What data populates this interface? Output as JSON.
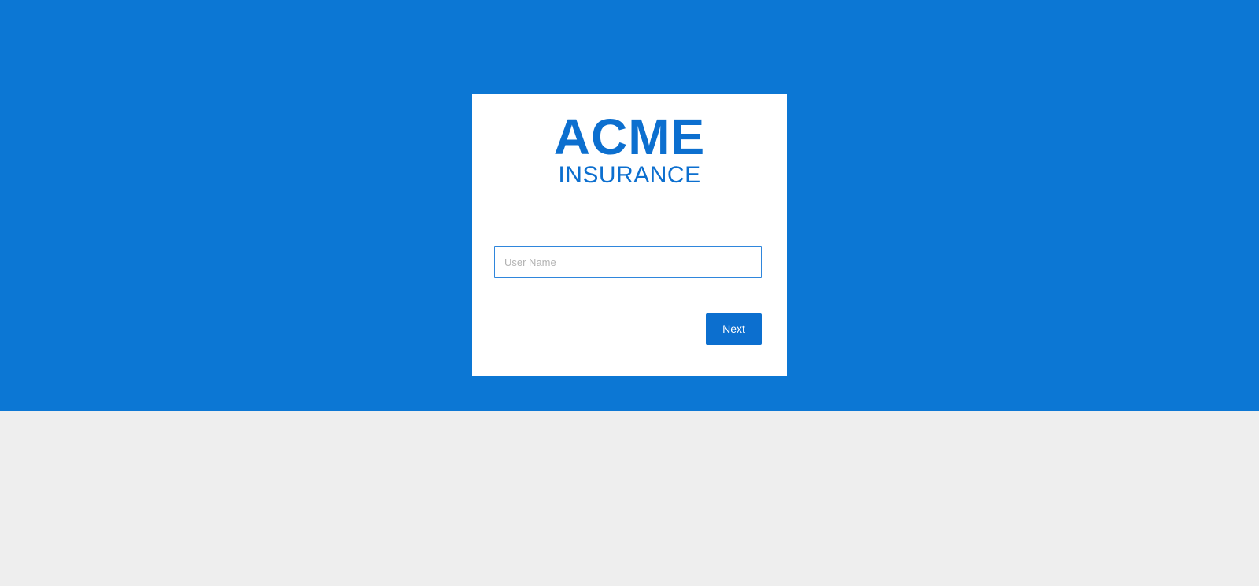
{
  "brand": {
    "name": "ACME",
    "tagline": "INSURANCE"
  },
  "login": {
    "username_placeholder": "User Name",
    "username_value": "",
    "next_label": "Next"
  },
  "colors": {
    "hero_background": "#0c77d4",
    "accent": "#0c6fcf",
    "page_background": "#eeeeee",
    "card_background": "#ffffff"
  }
}
